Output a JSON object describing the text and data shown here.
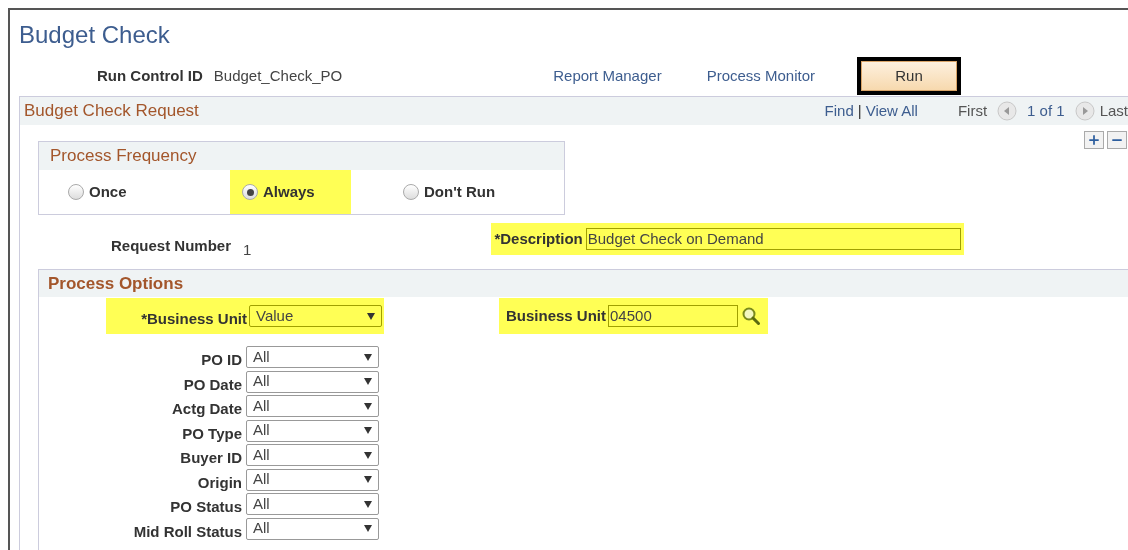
{
  "page_title": "Budget Check",
  "run_control": {
    "label": "Run Control ID",
    "value": "Budget_Check_PO"
  },
  "links": [
    "Report Manager",
    "Process Monitor"
  ],
  "run_button": {
    "label": "Run",
    "outlined": true
  },
  "request_panel": {
    "title": "Budget Check Request",
    "nav": {
      "find": "Find",
      "separator": "|",
      "view_all": "View All",
      "first": "First",
      "count": "1 of 1",
      "last": "Last"
    },
    "process_frequency": {
      "title": "Process Frequency",
      "options": [
        {
          "label": "Once",
          "selected": false,
          "highlighted": false
        },
        {
          "label": "Always",
          "selected": true,
          "highlighted": true
        },
        {
          "label": "Don't Run",
          "selected": false,
          "highlighted": false
        }
      ]
    },
    "request_number": {
      "label": "Request Number",
      "value": "1"
    },
    "description": {
      "label": "*Description",
      "value": "Budget Check on Demand",
      "highlighted": true
    },
    "process_options": {
      "title": "Process Options",
      "business_unit_select": {
        "label": "*Business Unit",
        "value": "Value",
        "highlighted": true
      },
      "business_unit_lookup": {
        "label": "Business Unit",
        "value": "04500",
        "highlighted": true
      },
      "filters": [
        {
          "label": "PO ID",
          "value": "All"
        },
        {
          "label": "PO Date",
          "value": "All"
        },
        {
          "label": "Actg Date",
          "value": "All"
        },
        {
          "label": "PO Type",
          "value": "All"
        },
        {
          "label": "Buyer ID",
          "value": "All"
        },
        {
          "label": "Origin",
          "value": "All"
        },
        {
          "label": "PO Status",
          "value": "All"
        },
        {
          "label": "Mid Roll Status",
          "value": "All"
        }
      ]
    }
  }
}
